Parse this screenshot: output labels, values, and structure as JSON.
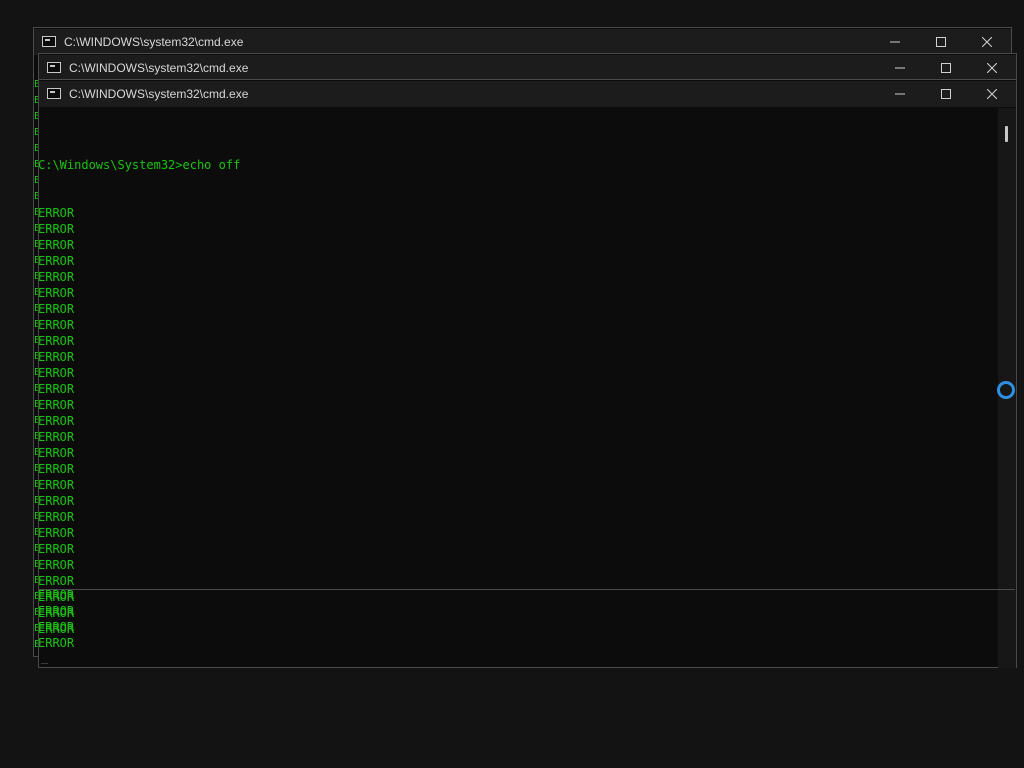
{
  "windows": [
    {
      "title": "C:\\WINDOWS\\system32\\cmd.exe"
    },
    {
      "title": "C:\\WINDOWS\\system32\\cmd.exe"
    },
    {
      "title": "C:\\WINDOWS\\system32\\cmd.exe"
    }
  ],
  "window_controls": {
    "minimize_icon": "minimize-icon",
    "maximize_icon": "maximize-icon",
    "close_icon": "close-icon"
  },
  "front_terminal": {
    "prompt_line": "C:\\Windows\\System32>echo off",
    "upper_lines": [
      "ERROR",
      "ERROR",
      "ERROR",
      "ERROR",
      "ERROR",
      "ERROR",
      "ERROR",
      "ERROR",
      "ERROR",
      "ERROR",
      "ERROR",
      "ERROR",
      "ERROR",
      "ERROR",
      "ERROR",
      "ERROR",
      "ERROR",
      "ERROR",
      "ERROR",
      "ERROR",
      "ERROR",
      "ERROR",
      "ERROR",
      "ERROR",
      "ERROR",
      "ERROR",
      "ERROR"
    ],
    "lower_lines": [
      "ERROR",
      "ERROR",
      "ERROR",
      "ERROR"
    ]
  },
  "colors": {
    "terminal_text": "#16c60c",
    "terminal_bg": "#0c0c0c",
    "titlebar_bg": "#1c1c1c",
    "busy_cursor": "#2f8fe0"
  }
}
